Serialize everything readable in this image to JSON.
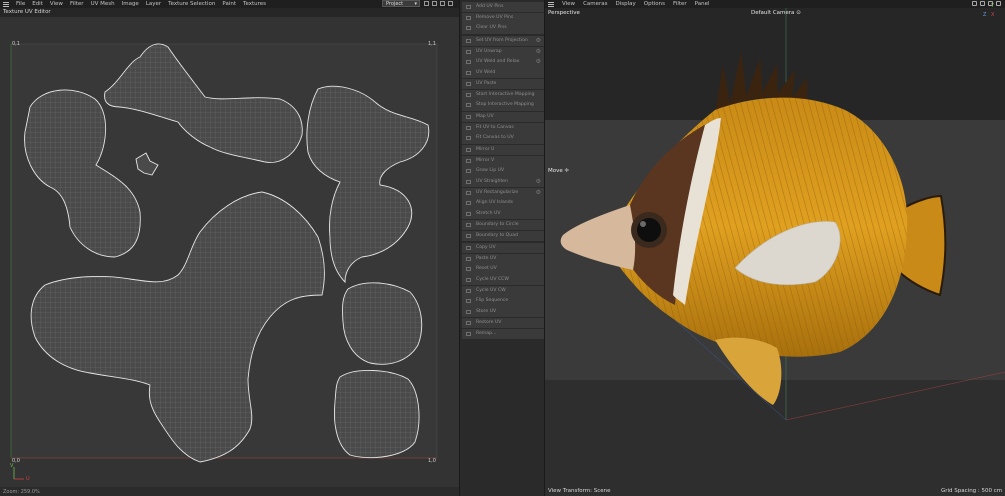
{
  "uv_editor": {
    "menu": [
      "File",
      "Edit",
      "View",
      "Filter",
      "UV Mesh",
      "Image",
      "Layer",
      "Texture Selection",
      "Paint",
      "Textures"
    ],
    "title": "Texture UV Editor",
    "mode_select": "Project",
    "corner_top_left": "0,1",
    "corner_top_right": "1,1",
    "corner_bottom_left": "0,0",
    "corner_bottom_right": "1,0",
    "axis_u": "U",
    "axis_v": "V",
    "zoom": "Zoom: 259.0%"
  },
  "commands": {
    "groups": [
      [
        "Add UV Pins",
        "Remove UV Pins",
        "Clear UV Pins"
      ],
      [
        "Set UV from Projection",
        "UV Unwrap",
        "UV Weld and Relax",
        "UV Weld"
      ],
      [
        "UV Paste",
        "Start Interactive Mapping",
        "Stop Interactive Mapping"
      ],
      [
        "Map UV",
        "Fit UV to Canvas",
        "Fit Canvas to UV"
      ],
      [
        "Mirror U",
        "Mirror V",
        "Grow Lip UV",
        "UV Straighten",
        "UV Rectangularize",
        "Align UV Islands",
        "Stretch UV",
        "Boundary to Circle",
        "Boundary to Quad"
      ],
      [
        "Copy UV",
        "Paste UV",
        "Reset UV",
        "Cycle UV CCW",
        "Cycle UV CW",
        "Flip Sequence",
        "Store UV",
        "Restore UV",
        "Remap..."
      ]
    ],
    "gear_items": [
      "Set UV from Projection",
      "UV Unwrap",
      "UV Weld and Relax",
      "UV Straighten",
      "UV Rectangularize"
    ]
  },
  "viewport": {
    "menu": [
      "View",
      "Cameras",
      "Display",
      "Options",
      "Filter",
      "Panel"
    ],
    "projection": "Perspective",
    "camera": "Default Camera",
    "tool": "Move",
    "view_transform": "View Transform: Scene",
    "grid_spacing": "Grid Spacing : 500 cm",
    "axis_x": "X",
    "axis_y": "Y",
    "axis_z": "Z"
  }
}
